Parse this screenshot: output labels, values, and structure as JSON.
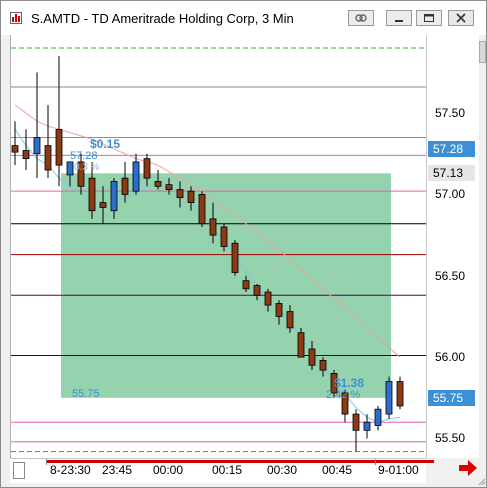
{
  "window": {
    "title": "S.AMTD - TD Ameritrade Holding Corp, 3 Min"
  },
  "icons": {
    "app": "chart-app-icon",
    "link": "link-icon",
    "minimize": "minimize-icon",
    "maximize": "maximize-icon",
    "close": "close-icon",
    "forward": "forward-arrow-icon"
  },
  "price_axis": {
    "ticks": [
      "57.50",
      "57.00",
      "56.50",
      "56.00",
      "55.50"
    ],
    "badges": [
      {
        "label": "57.28",
        "value": 57.28,
        "bg": "#3d8fd6",
        "fg": "#ffffff"
      },
      {
        "label": "57.13",
        "value": 57.13,
        "bg": "#e6e6e6",
        "fg": "#000000"
      },
      {
        "label": "55.75",
        "value": 55.75,
        "bg": "#3d8fd6",
        "fg": "#ffffff"
      }
    ]
  },
  "time_axis": {
    "ticks": [
      "8-23:30",
      "23:45",
      "00:00",
      "00:15",
      "00:30",
      "00:45",
      "9-01:00"
    ]
  },
  "drawing": {
    "top_change": "$0.15",
    "top_price": "57.28",
    "top_pct": "0.3 %",
    "bottom_price": "55.75",
    "right_change": "$1.38",
    "right_pct": "2.42 %",
    "box_color": "#8ed1aa",
    "label_color": "#3d8fd6"
  },
  "chart_data": {
    "type": "candlestick",
    "symbol": "S.AMTD",
    "interval": "3 Min",
    "ylim": [
      55.38,
      57.98
    ],
    "x_ticks": [
      "8-23:30",
      "23:45",
      "00:00",
      "00:15",
      "00:30",
      "00:45",
      "9-01:00"
    ],
    "candles": [
      {
        "o": 57.3,
        "h": 57.45,
        "l": 57.18,
        "c": 57.26,
        "up": false
      },
      {
        "o": 57.27,
        "h": 57.4,
        "l": 57.15,
        "c": 57.22,
        "up": false
      },
      {
        "o": 57.25,
        "h": 57.75,
        "l": 57.1,
        "c": 57.35,
        "up": true
      },
      {
        "o": 57.3,
        "h": 57.55,
        "l": 57.1,
        "c": 57.15,
        "up": false
      },
      {
        "o": 57.4,
        "h": 57.85,
        "l": 57.05,
        "c": 57.18,
        "up": false
      },
      {
        "o": 57.12,
        "h": 57.2,
        "l": 57.05,
        "c": 57.2,
        "up": true
      },
      {
        "o": 57.2,
        "h": 57.25,
        "l": 57.0,
        "c": 57.05,
        "up": false
      },
      {
        "o": 57.1,
        "h": 57.2,
        "l": 56.85,
        "c": 56.9,
        "up": false
      },
      {
        "o": 56.95,
        "h": 57.05,
        "l": 56.82,
        "c": 56.92,
        "up": false
      },
      {
        "o": 56.9,
        "h": 57.1,
        "l": 56.85,
        "c": 57.08,
        "up": true
      },
      {
        "o": 57.1,
        "h": 57.2,
        "l": 56.95,
        "c": 57.0,
        "up": false
      },
      {
        "o": 57.02,
        "h": 57.25,
        "l": 57.0,
        "c": 57.2,
        "up": true
      },
      {
        "o": 57.22,
        "h": 57.25,
        "l": 57.05,
        "c": 57.1,
        "up": false
      },
      {
        "o": 57.08,
        "h": 57.15,
        "l": 57.03,
        "c": 57.05,
        "up": false
      },
      {
        "o": 57.06,
        "h": 57.1,
        "l": 57.0,
        "c": 57.03,
        "up": false
      },
      {
        "o": 57.03,
        "h": 57.08,
        "l": 56.92,
        "c": 56.98,
        "up": false
      },
      {
        "o": 57.02,
        "h": 57.05,
        "l": 56.9,
        "c": 56.95,
        "up": false
      },
      {
        "o": 57.0,
        "h": 57.02,
        "l": 56.8,
        "c": 56.82,
        "up": false
      },
      {
        "o": 56.85,
        "h": 56.95,
        "l": 56.7,
        "c": 56.75,
        "up": false
      },
      {
        "o": 56.8,
        "h": 56.82,
        "l": 56.65,
        "c": 56.68,
        "up": false
      },
      {
        "o": 56.7,
        "h": 56.72,
        "l": 56.5,
        "c": 56.52,
        "up": false
      },
      {
        "o": 56.47,
        "h": 56.5,
        "l": 56.4,
        "c": 56.42,
        "up": false
      },
      {
        "o": 56.44,
        "h": 56.45,
        "l": 56.35,
        "c": 56.38,
        "up": false
      },
      {
        "o": 56.4,
        "h": 56.42,
        "l": 56.28,
        "c": 56.32,
        "up": false
      },
      {
        "o": 56.33,
        "h": 56.35,
        "l": 56.2,
        "c": 56.25,
        "up": false
      },
      {
        "o": 56.28,
        "h": 56.32,
        "l": 56.15,
        "c": 56.18,
        "up": false
      },
      {
        "o": 56.15,
        "h": 56.18,
        "l": 56.0,
        "c": 56.0,
        "up": false
      },
      {
        "o": 56.05,
        "h": 56.1,
        "l": 55.92,
        "c": 55.95,
        "up": false
      },
      {
        "o": 55.98,
        "h": 56.0,
        "l": 55.88,
        "c": 55.92,
        "up": false
      },
      {
        "o": 55.9,
        "h": 55.92,
        "l": 55.75,
        "c": 55.78,
        "up": false
      },
      {
        "o": 55.78,
        "h": 55.8,
        "l": 55.6,
        "c": 55.65,
        "up": false
      },
      {
        "o": 55.65,
        "h": 55.68,
        "l": 55.42,
        "c": 55.55,
        "up": false
      },
      {
        "o": 55.55,
        "h": 55.65,
        "l": 55.5,
        "c": 55.6,
        "up": true
      },
      {
        "o": 55.58,
        "h": 55.7,
        "l": 55.55,
        "c": 55.68,
        "up": true
      },
      {
        "o": 55.65,
        "h": 55.88,
        "l": 55.62,
        "c": 55.85,
        "up": true
      },
      {
        "o": 55.85,
        "h": 55.88,
        "l": 55.68,
        "c": 55.7,
        "up": false
      }
    ],
    "levels": [
      {
        "value": 57.9,
        "color": "#2fb82f",
        "dash": true
      },
      {
        "value": 57.66,
        "color": "#888888",
        "dash": false
      },
      {
        "value": 57.35,
        "color": "#e060b0",
        "dash": false
      },
      {
        "value": 57.24,
        "color": "#e060b0",
        "dash": false
      },
      {
        "value": 57.02,
        "color": "#e060b0",
        "dash": false
      },
      {
        "value": 56.82,
        "color": "#000000",
        "dash": false
      },
      {
        "value": 56.63,
        "color": "#a00000",
        "dash": false
      },
      {
        "value": 56.38,
        "color": "#5a005a",
        "dash": false
      },
      {
        "value": 56.01,
        "color": "#0000c0",
        "dash": false
      },
      {
        "value": 55.6,
        "color": "#e060b0",
        "dash": false
      },
      {
        "value": 55.48,
        "color": "#e060b0",
        "dash": false
      },
      {
        "value": 55.42,
        "color": "#2fb82f",
        "dash": true
      }
    ],
    "box": {
      "y_top": 57.13,
      "y_bottom": 55.75
    },
    "ma_fast": [
      57.4,
      57.3,
      57.22,
      57.18,
      57.1,
      57.05,
      57.0,
      56.95,
      56.92,
      56.95,
      56.98,
      57.0,
      57.05,
      57.06,
      57.04,
      57.0,
      56.95,
      56.88,
      56.8,
      56.72,
      56.62,
      56.52,
      56.44,
      56.37,
      56.3,
      56.22,
      56.12,
      56.03,
      55.95,
      55.86,
      55.77,
      55.69,
      55.63,
      55.6,
      55.62,
      55.63
    ],
    "ma_slow": [
      57.55,
      57.5,
      57.45,
      57.42,
      57.4,
      57.38,
      57.36,
      57.34,
      57.31,
      57.28,
      57.25,
      57.22,
      57.2,
      57.18,
      57.14,
      57.1,
      57.06,
      57.02,
      56.97,
      56.92,
      56.87,
      56.82,
      56.77,
      56.71,
      56.66,
      56.6,
      56.54,
      56.48,
      56.42,
      56.36,
      56.3,
      56.24,
      56.18,
      56.12,
      56.06,
      56.0
    ]
  }
}
